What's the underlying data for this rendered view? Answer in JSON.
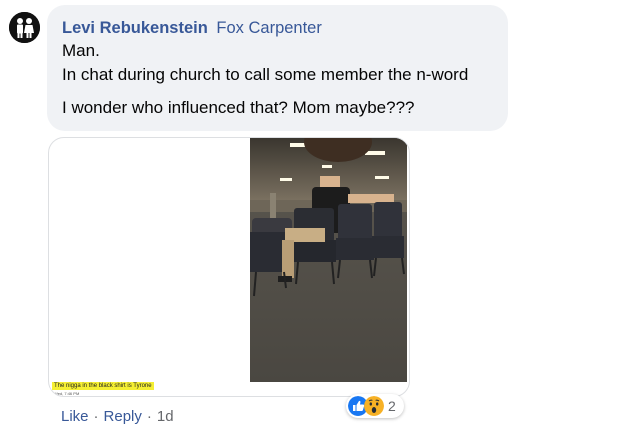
{
  "comment": {
    "author": "Levi Rebukenstein",
    "tagged_name": "Fox Carpenter",
    "lines": [
      "Man.",
      "In chat during church to call some member the n-word",
      "I wonder who influenced that? Mom maybe???"
    ]
  },
  "attachment": {
    "caption": "The nigga in the black shirt is Tyrone",
    "caption_meta": "Wed, 7:46 PM"
  },
  "actions": {
    "like_label": "Like",
    "separator": "·",
    "reply_label": "Reply",
    "age": "1d"
  },
  "reactions": {
    "icons": [
      "like-reaction-icon",
      "wow-reaction-icon"
    ],
    "count": "2",
    "colors": {
      "like": "#1877f2",
      "wow": "#f7b125"
    }
  },
  "colors": {
    "link": "#385898",
    "bubble": "#f0f2f5",
    "muted": "#65676b",
    "highlight": "#f5ef33"
  }
}
